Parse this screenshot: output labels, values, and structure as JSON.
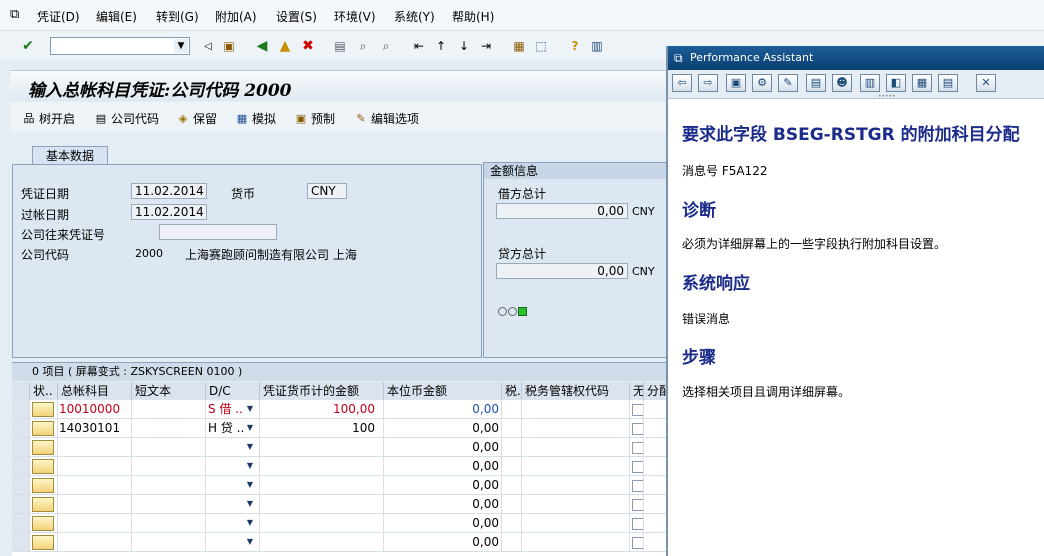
{
  "menu": {
    "items": [
      "凭证(D)",
      "编辑(E)",
      "转到(G)",
      "附加(A)",
      "设置(S)",
      "环境(V)",
      "系统(Y)",
      "帮助(H)"
    ]
  },
  "toolbar": {
    "icons": [
      "enter-icon",
      "command-field",
      "back-icon",
      "save-icon",
      "back-green-icon",
      "exit-icon",
      "cancel-icon",
      "print-icon",
      "find-icon",
      "find-next-icon",
      "first-page-icon",
      "prev-page-icon",
      "next-page-icon",
      "last-page-icon",
      "new-session-icon",
      "shortcut-icon",
      "help-icon",
      "layout-icon"
    ]
  },
  "screen": {
    "title": "输入总帐科目凭证:公司代码 2000"
  },
  "app_toolbar": {
    "tree_label": "树开启",
    "company_label": "公司代码",
    "park_label": "保留",
    "simulate_label": "模拟",
    "hold_label": "预制",
    "options_label": "编辑选项"
  },
  "basic_tab": {
    "tab_label": "基本数据",
    "doc_date_label": "凭证日期",
    "doc_date_value": "11.02.2014",
    "currency_label": "货币",
    "currency_value": "CNY",
    "post_date_label": "过帐日期",
    "post_date_value": "11.02.2014",
    "intercompany_label": "公司往来凭证号",
    "intercompany_value": "",
    "company_code_label": "公司代码",
    "company_code_value": "2000",
    "company_name": "上海赛跑顾问制造有限公司 上海"
  },
  "amount_info": {
    "group_label": "金额信息",
    "debit_label": "借方总计",
    "debit_value": "0,00",
    "debit_currency": "CNY",
    "credit_label": "贷方总计",
    "credit_value": "0,00",
    "credit_currency": "CNY"
  },
  "items_table": {
    "header_text": "0 项目 ( 屏幕变式 : ZSKYSCREEN 0100 )",
    "columns": [
      "状..",
      "总帐科目",
      "短文本",
      "D/C",
      "凭证货币计的金额",
      "本位币金额",
      "税..",
      "税务管辖权代码",
      "无",
      "分配"
    ],
    "rows": [
      {
        "account": "10010000",
        "short_text": "",
        "dc": "S 借 ..",
        "doc_amount": "100,00",
        "local_amount": "0,00"
      },
      {
        "account": "14030101",
        "short_text": "",
        "dc": "H 贷 ..",
        "doc_amount": "100",
        "local_amount": "0,00"
      },
      {
        "account": "",
        "short_text": "",
        "dc": "",
        "doc_amount": "",
        "local_amount": "0,00"
      },
      {
        "account": "",
        "short_text": "",
        "dc": "",
        "doc_amount": "",
        "local_amount": "0,00"
      },
      {
        "account": "",
        "short_text": "",
        "dc": "",
        "doc_amount": "",
        "local_amount": "0,00"
      },
      {
        "account": "",
        "short_text": "",
        "dc": "",
        "doc_amount": "",
        "local_amount": "0,00"
      },
      {
        "account": "",
        "short_text": "",
        "dc": "",
        "doc_amount": "",
        "local_amount": "0,00"
      },
      {
        "account": "",
        "short_text": "",
        "dc": "",
        "doc_amount": "",
        "local_amount": "0,00"
      }
    ]
  },
  "performance_assistant": {
    "title": "Performance Assistant",
    "heading": "要求此字段  BSEG-RSTGR 的附加科目分配",
    "message_no": "消息号  F5A122",
    "diag_heading": "诊断",
    "diag_text": "必须为详细屏幕上的一些字段执行附加科目设置。",
    "response_heading": "系统响应",
    "response_text": "错误消息",
    "steps_heading": "步骤",
    "steps_text": "选择相关项目且调用详细屏幕。"
  },
  "colors": {
    "title_bar": "#0b3f72",
    "heading_blue": "#1a2b8a",
    "account_red": "#c0001a",
    "local_amount_blue": "#1b4fa8"
  }
}
